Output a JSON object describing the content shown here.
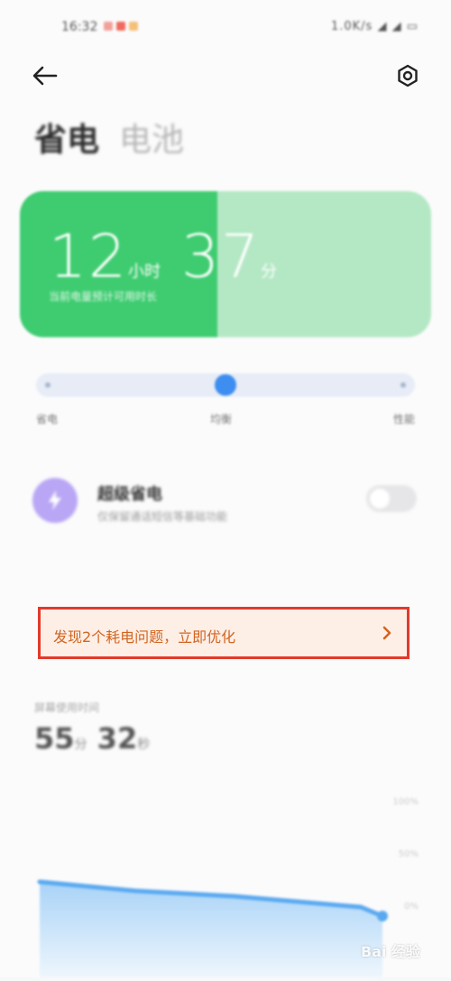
{
  "status_bar": {
    "time": "16:32",
    "right": "1.0K/s ◢ ◢ ▭"
  },
  "header": {
    "back_icon": "arrow-left-icon",
    "settings_icon": "gear-icon",
    "tabs": [
      {
        "label": "省电",
        "active": true
      },
      {
        "label": "电池",
        "active": false
      }
    ]
  },
  "battery": {
    "hours": "12",
    "hours_unit": "小时",
    "minutes": "37",
    "minutes_unit": "分",
    "subtitle": "当前电量预计可用时长",
    "level": 0.48,
    "colors": {
      "fill": "#3fcc70",
      "track": "#b4e8c4"
    }
  },
  "mode_slider": {
    "labels": [
      "省电",
      "均衡",
      "性能"
    ],
    "selected_index": 1,
    "position": 0.5,
    "accent": "#3d8ef0"
  },
  "ultra_saver": {
    "title": "超级省电",
    "subtitle": "仅保留通话短信等基础功能",
    "icon": "lightning-icon",
    "enabled": false
  },
  "optimize_banner": {
    "text": "发现2个耗电问题，立即优化",
    "icon": "chevron-right-icon",
    "highlight_color": "#e23a2b",
    "text_color": "#d1651f"
  },
  "usage": {
    "label": "屏幕使用时间",
    "value_minutes": "55",
    "minutes_unit": "分",
    "value_seconds": "32",
    "seconds_unit": "秒",
    "ticks": [
      "100%",
      "50%",
      "0%"
    ],
    "chart_line_color": "#5aa9f0"
  },
  "watermark": "Bai 经验"
}
